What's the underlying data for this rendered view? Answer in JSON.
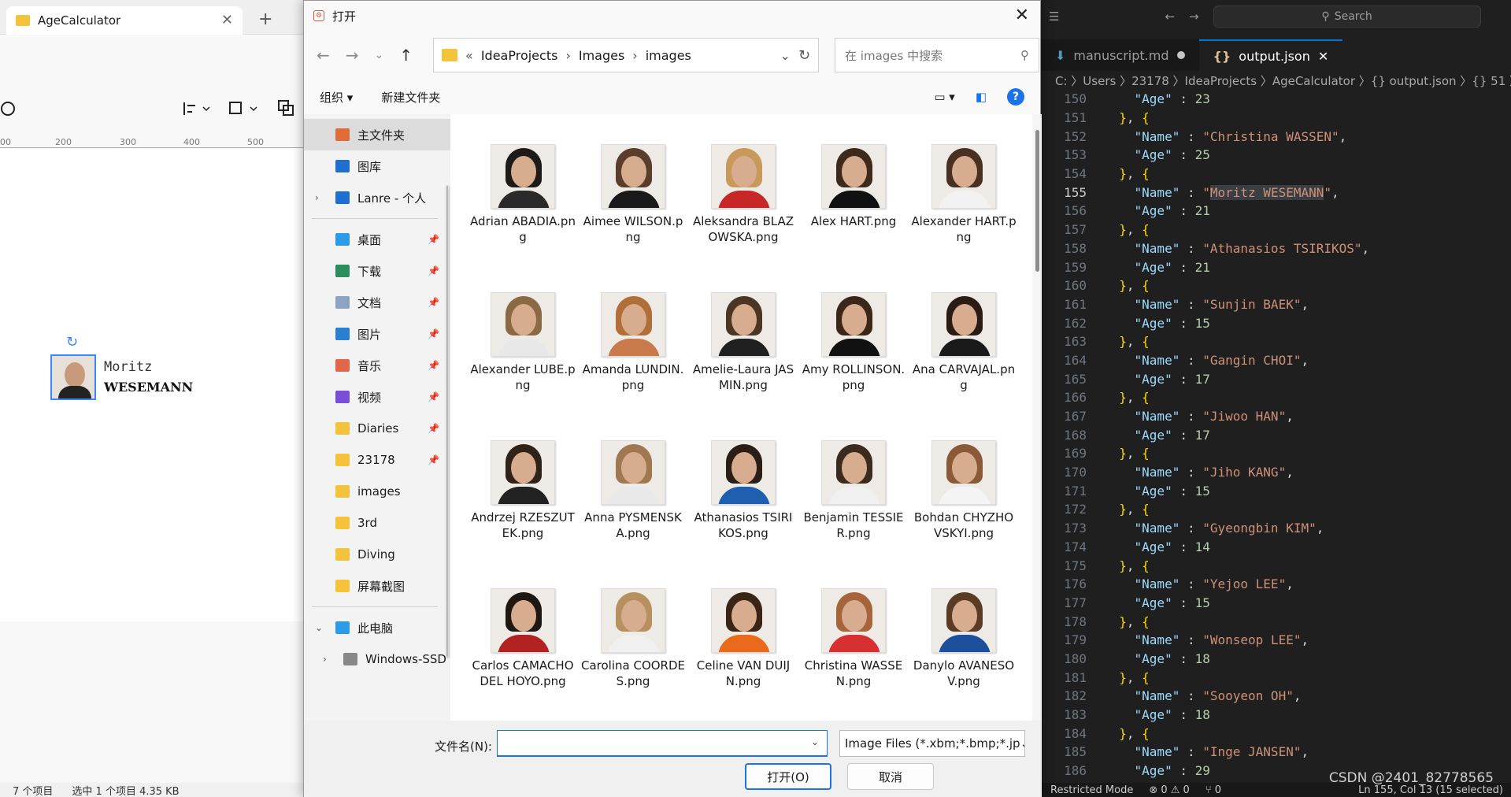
{
  "bg_app": {
    "tab_title": "AgeCalculator",
    "ruler_ticks": [
      "00",
      "200",
      "300",
      "400",
      "500"
    ],
    "card_name_line1": "Moritz",
    "card_name_line2": "WESEMANN",
    "status_items": "7 个项目",
    "status_selected": "选中 1 个项目  4.35 KB"
  },
  "dialog": {
    "title": "打开",
    "address": {
      "overflow": "«",
      "crumbs": [
        "IdeaProjects",
        "Images",
        "images"
      ]
    },
    "search_placeholder": "在 images 中搜索",
    "organize": "组织 ▾",
    "new_folder": "新建文件夹",
    "sidebar": [
      {
        "label": "主文件夹",
        "icon": "home-icon",
        "color": "#e06c3a",
        "selected": true
      },
      {
        "label": "图库",
        "icon": "gallery-icon",
        "color": "#1f6fd1"
      },
      {
        "label": "Lanre - 个人",
        "icon": "onedrive-icon",
        "color": "#1f6fd1",
        "expand": true
      },
      {
        "divider": true
      },
      {
        "label": "桌面",
        "icon": "desktop-icon",
        "color": "#2b9be8",
        "pinned": true
      },
      {
        "label": "下载",
        "icon": "download-icon",
        "color": "#2a8f5c",
        "pinned": true
      },
      {
        "label": "文档",
        "icon": "documents-icon",
        "color": "#8ea2c2",
        "pinned": true
      },
      {
        "label": "图片",
        "icon": "pictures-icon",
        "color": "#2b7fd1",
        "pinned": true
      },
      {
        "label": "音乐",
        "icon": "music-icon",
        "color": "#e2664a",
        "pinned": true
      },
      {
        "label": "视频",
        "icon": "videos-icon",
        "color": "#7a4fd8",
        "pinned": true
      },
      {
        "label": "Diaries",
        "icon": "folder-icon",
        "color": "#f3c33b",
        "pinned": true
      },
      {
        "label": "23178",
        "icon": "folder-icon",
        "color": "#f3c33b",
        "pinned": true
      },
      {
        "label": "images",
        "icon": "folder-icon",
        "color": "#f3c33b"
      },
      {
        "label": "3rd",
        "icon": "folder-icon",
        "color": "#f3c33b"
      },
      {
        "label": "Diving",
        "icon": "folder-icon",
        "color": "#f3c33b"
      },
      {
        "label": "屏幕截图",
        "icon": "folder-icon",
        "color": "#f3c33b"
      },
      {
        "divider": true
      },
      {
        "label": "此电脑",
        "icon": "computer-icon",
        "color": "#2b9be8",
        "expanded": true
      },
      {
        "label": "Windows-SSD",
        "icon": "drive-icon",
        "color": "#888888",
        "expand": true,
        "indent": true
      }
    ],
    "files": [
      {
        "name": "Adrian ABADIA.png",
        "hair": "#1e1a18",
        "shirt": "#2a2a2a"
      },
      {
        "name": "Aimee WILSON.png",
        "hair": "#5a3d2b",
        "shirt": "#1a1a1a"
      },
      {
        "name": "Aleksandra BLAZOWSKA.png",
        "hair": "#c79a5b",
        "shirt": "#c62828"
      },
      {
        "name": "Alex HART.png",
        "hair": "#3d2a1c",
        "shirt": "#111111"
      },
      {
        "name": "Alexander HART.png",
        "hair": "#4a3020",
        "shirt": "#f2f2f2"
      },
      {
        "name": "Alexander LUBE.png",
        "hair": "#8a6a45",
        "shirt": "#e8e8e8"
      },
      {
        "name": "Amanda LUNDIN.png",
        "hair": "#b06f38",
        "shirt": "#c97a4a"
      },
      {
        "name": "Amelie-Laura JASMIN.png",
        "hair": "#4b3624",
        "shirt": "#202020"
      },
      {
        "name": "Amy ROLLINSON.png",
        "hair": "#3a2718",
        "shirt": "#111111"
      },
      {
        "name": "Ana CARVAJAL.png",
        "hair": "#2a1c14",
        "shirt": "#1a1a1a"
      },
      {
        "name": "Andrzej RZESZUTEK.png",
        "hair": "#2f2218",
        "shirt": "#222222"
      },
      {
        "name": "Anna PYSMENSKA.png",
        "hair": "#a07850",
        "shirt": "#e9e9e9"
      },
      {
        "name": "Athanasios TSIRIKOS.png",
        "hair": "#2a1e16",
        "shirt": "#1e5fb0"
      },
      {
        "name": "Benjamin TESSIER.png",
        "hair": "#3b2a1e",
        "shirt": "#f0f0f0"
      },
      {
        "name": "Bohdan CHYZHOVSKYI.png",
        "hair": "#8a5a38",
        "shirt": "#f4f4f4"
      },
      {
        "name": "Carlos CAMACHO DEL HOYO.png",
        "hair": "#1f1812",
        "shirt": "#b22222"
      },
      {
        "name": "Carolina COORDES.png",
        "hair": "#b79060",
        "shirt": "#f0f0f0"
      },
      {
        "name": "Celine VAN DUIJN.png",
        "hair": "#3a2416",
        "shirt": "#e86a1a"
      },
      {
        "name": "Christina WASSEN.png",
        "hair": "#a5643a",
        "shirt": "#d63031"
      },
      {
        "name": "Danylo AVANESOV.png",
        "hair": "#5a3c24",
        "shirt": "#1e4f9c"
      }
    ],
    "filename_label": "文件名(N):",
    "filename_value": "",
    "filetype": "Image Files (*.xbm;*.bmp;*.jp",
    "open_button": "打开(O)",
    "cancel_button": "取消"
  },
  "vscode": {
    "search": "Search",
    "tabs": [
      {
        "label": "manuscript.md",
        "active": false,
        "dirty": true
      },
      {
        "label": "output.json",
        "active": true
      }
    ],
    "breadcrumb": "C: 〉Users 〉23178 〉IdeaProjects 〉AgeCalculator 〉{} output.json 〉{} 51 〉",
    "first_line_number": 150,
    "current_line": 155,
    "entries": [
      {
        "name": "Christina WASSEN",
        "age": 25
      },
      {
        "name": "Moritz WESEMANN",
        "age": 21
      },
      {
        "name": "Athanasios TSIRIKOS",
        "age": 21
      },
      {
        "name": "Sunjin BAEK",
        "age": 15
      },
      {
        "name": "Gangin CHOI",
        "age": 17
      },
      {
        "name": "Jiwoo HAN",
        "age": 17
      },
      {
        "name": "Jiho KANG",
        "age": 15
      },
      {
        "name": "Gyeongbin KIM",
        "age": 14
      },
      {
        "name": "Yejoo LEE",
        "age": 15
      },
      {
        "name": "Wonseop LEE",
        "age": 18
      },
      {
        "name": "Sooyeon OH",
        "age": 18
      },
      {
        "name": "Inge JANSEN",
        "age": 29
      }
    ],
    "prev_age": 23,
    "status_left": "Restricted Mode",
    "status_problems": "⊗ 0 ⚠ 0",
    "status_ports": "⑂ 0",
    "status_right": "Ln 155, Col 13 (15 selected)",
    "watermark": "CSDN @2401_82778565"
  }
}
